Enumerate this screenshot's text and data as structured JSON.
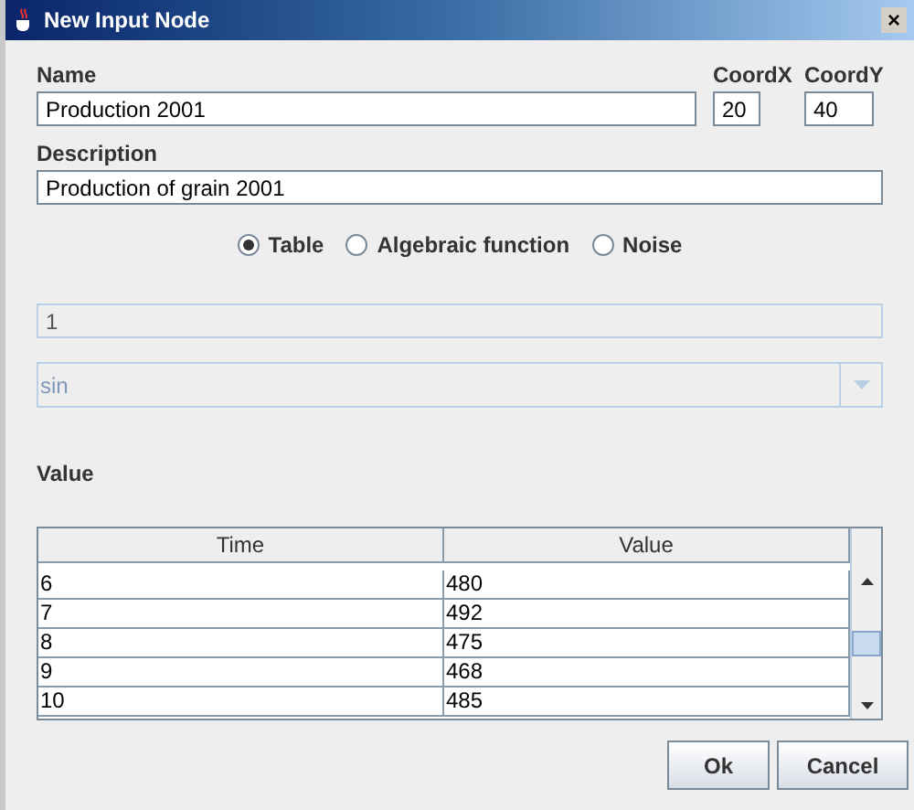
{
  "window": {
    "title": "New Input Node",
    "close": "×"
  },
  "name": {
    "label": "Name",
    "value": "Production 2001"
  },
  "coord_x": {
    "label": "CoordX",
    "value": "20"
  },
  "coord_y": {
    "label": "CoordY",
    "value": "40"
  },
  "description": {
    "label": "Description",
    "value": "Production of grain 2001"
  },
  "source": [
    {
      "label": "Table",
      "selected": true
    },
    {
      "label": "Algebraic function",
      "selected": false
    },
    {
      "label": "Noise",
      "selected": false
    }
  ],
  "constant_field": {
    "value": "1",
    "disabled": true
  },
  "function_combo": {
    "value": "sin",
    "disabled": true
  },
  "value_label": "Value",
  "table": {
    "columns": [
      "Time",
      "Value"
    ],
    "rows": [
      [
        "6",
        "480"
      ],
      [
        "7",
        "492"
      ],
      [
        "8",
        "475"
      ],
      [
        "9",
        "468"
      ],
      [
        "10",
        "485"
      ]
    ]
  },
  "buttons": [
    "Ok",
    "Cancel"
  ]
}
